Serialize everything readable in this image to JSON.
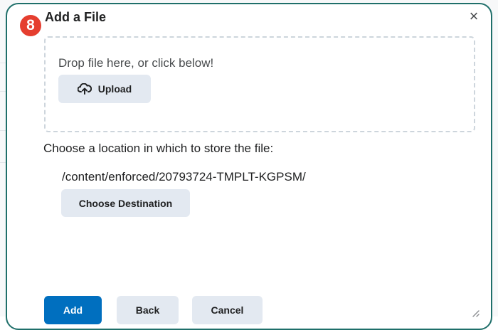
{
  "step_number": "8",
  "dialog": {
    "title": "Add a File",
    "close_symbol": "×"
  },
  "dropzone": {
    "prompt": "Drop file here, or click below!",
    "upload_label": "Upload",
    "upload_icon": "cloud-upload-icon"
  },
  "location": {
    "label": "Choose a location in which to store the file:",
    "path": "/content/enforced/20793724-TMPLT-KGPSM/",
    "choose_label": "Choose Destination"
  },
  "footer": {
    "add_label": "Add",
    "back_label": "Back",
    "cancel_label": "Cancel"
  },
  "colors": {
    "primary_button": "#006fbf",
    "secondary_button": "#e3e9f1",
    "badge": "#e53e2f",
    "frame": "#1f6f6a"
  }
}
